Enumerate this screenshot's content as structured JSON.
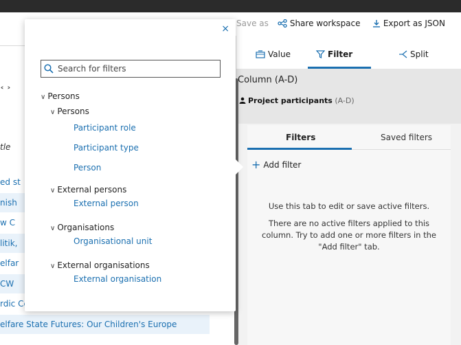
{
  "toolbar": {
    "save_as_label": "Save as",
    "share_label": "Share workspace",
    "export_label": "Export as JSON"
  },
  "left": {
    "nav_stub": "˂ ˃",
    "column_head": "tle",
    "rows": [
      {
        "text": "ed st",
        "alt": false
      },
      {
        "text": "nish",
        "alt": true
      },
      {
        "text": "w C",
        "alt": false
      },
      {
        "text": "litik,",
        "alt": true
      },
      {
        "text": "elfar",
        "alt": false
      },
      {
        "text": "CW",
        "alt": true
      },
      {
        "text": "rdic Centre of Excellence in Welfare Research",
        "alt": false
      },
      {
        "text": "elfare State Futures: Our Children's Europe",
        "alt": true
      }
    ]
  },
  "right_panel": {
    "tabs": {
      "value": "Value",
      "filter": "Filter",
      "split": "Split"
    },
    "column_title": "Column (A-D)",
    "source_bold": "Project participants",
    "source_range": "(A-D)",
    "subtabs": {
      "filters": "Filters",
      "saved": "Saved filters"
    },
    "add_filter": "Add filter",
    "help": [
      "Use this tab to edit or save active filters.",
      "There are no active filters applied to this column. Try to add one or more filters in the \"Add filter\" tab."
    ]
  },
  "popup": {
    "search_placeholder": "Search for filters",
    "close": "×",
    "tree": {
      "root": "Persons",
      "groups": [
        {
          "label": "Persons",
          "items": [
            "Participant role",
            "Participant type",
            "Person"
          ]
        },
        {
          "label": "External persons",
          "items": [
            "External person"
          ]
        },
        {
          "label": "Organisations",
          "items": [
            "Organisational unit"
          ]
        },
        {
          "label": "External organisations",
          "items": [
            "External organisation"
          ]
        }
      ]
    }
  },
  "colors": {
    "accent": "#1a6fb0",
    "topbar": "#2b2b2b",
    "panel_bg": "#f2f2f2",
    "row_alt": "#e9f2fa"
  }
}
